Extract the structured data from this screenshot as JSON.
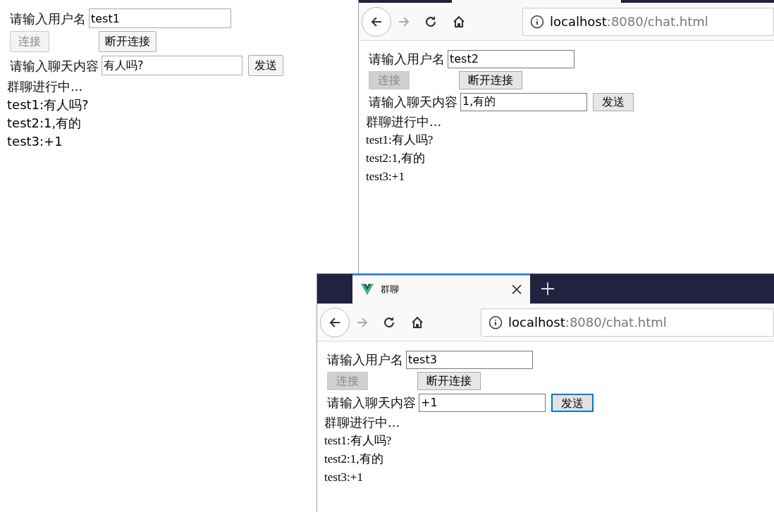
{
  "windows": [
    {
      "kind": "bare",
      "username_label": "请输入用户名",
      "username": "test1",
      "connect": {
        "label": "连接",
        "disabled": true
      },
      "disconnect": {
        "label": "断开连接",
        "disabled": false
      },
      "message_label": "请输入聊天内容",
      "message": "有人吗?",
      "send": {
        "label": "发送",
        "focused": false
      },
      "status": "群聊进行中...",
      "messages": [
        "test1:有人吗?",
        "test2:1,有的",
        "test3:+1"
      ]
    },
    {
      "kind": "browser",
      "url_host": "localhost",
      "url_path": ":8080/chat.html",
      "username_label": "请输入用户名",
      "username": "test2",
      "connect": {
        "label": "连接",
        "disabled": true
      },
      "disconnect": {
        "label": "断开连接",
        "disabled": false
      },
      "message_label": "请输入聊天内容",
      "message": "1,有的",
      "send": {
        "label": "发送",
        "focused": false
      },
      "status": "群聊进行中...",
      "messages": [
        "test1:有人吗?",
        "test2:1,有的",
        "test3:+1"
      ]
    },
    {
      "kind": "browser",
      "tab": {
        "title": "群聊"
      },
      "url_host": "localhost",
      "url_path": ":8080/chat.html",
      "username_label": "请输入用户名",
      "username": "test3",
      "connect": {
        "label": "连接",
        "disabled": true
      },
      "disconnect": {
        "label": "断开连接",
        "disabled": false
      },
      "message_label": "请输入聊天内容",
      "message": "+1",
      "send": {
        "label": "发送",
        "focused": true
      },
      "status": "群聊进行中...",
      "messages": [
        "test1:有人吗?",
        "test2:1,有的",
        "test3:+1"
      ]
    }
  ]
}
